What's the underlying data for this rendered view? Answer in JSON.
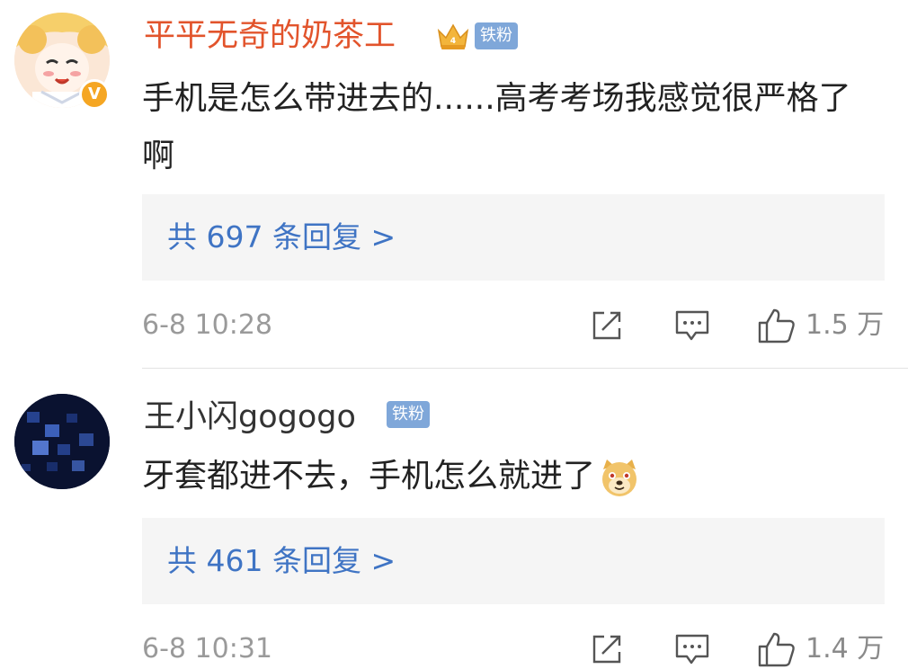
{
  "comments": [
    {
      "username": "平平无奇的奶茶工",
      "fan_badge": "铁粉",
      "content": "手机是怎么带进去的......高考考场我感觉很严格了啊",
      "replies_label": "共 697 条回复 >",
      "timestamp": "6-8 10:28",
      "likes": "1.5 万"
    },
    {
      "username": "王小闪gogogo",
      "fan_badge": "铁粉",
      "content": "牙套都进不去，手机怎么就进了",
      "replies_label": "共 461 条回复 >",
      "timestamp": "6-8 10:31",
      "likes": "1.4 万"
    }
  ],
  "colors": {
    "highlight_username": "#e2542c",
    "reply_link": "#3f74c4",
    "fan_badge": "#7fa7d9",
    "verified_badge": "#f5a623"
  },
  "icons": [
    "verified-v-icon",
    "crown-icon",
    "share-icon",
    "comment-icon",
    "thumbs-up-icon",
    "doge-emoji-icon"
  ]
}
